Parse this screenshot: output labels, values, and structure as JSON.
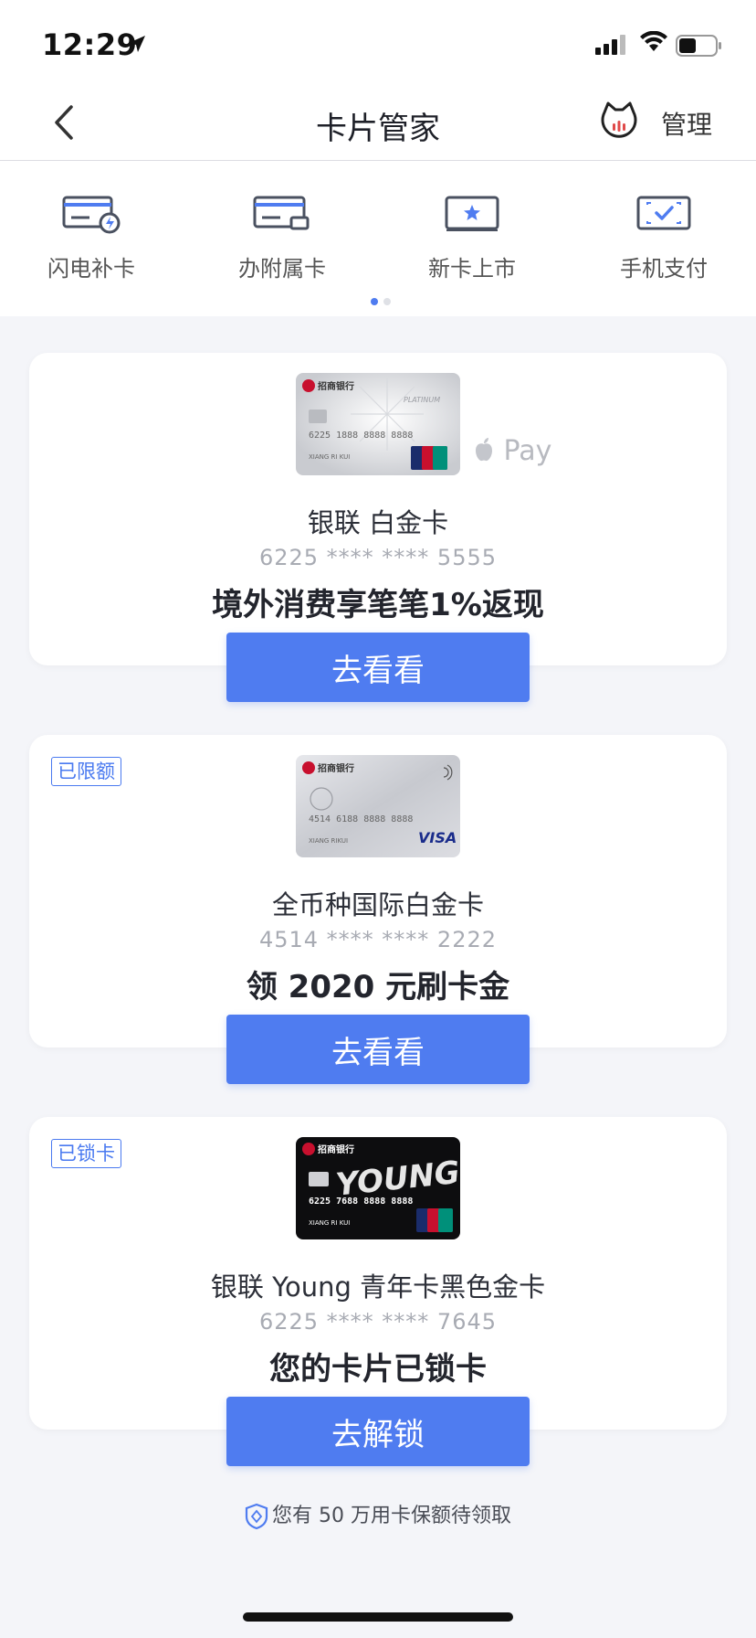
{
  "status_bar": {
    "time": "12:29"
  },
  "nav": {
    "title": "卡片管家",
    "manage_label": "管理"
  },
  "quick_actions": [
    {
      "label": "闪电补卡",
      "icon": "card-lightning-icon"
    },
    {
      "label": "办附属卡",
      "icon": "card-secondary-icon"
    },
    {
      "label": "新卡上市",
      "icon": "card-star-icon"
    },
    {
      "label": "手机支付",
      "icon": "card-check-icon"
    }
  ],
  "cards": [
    {
      "badge": "",
      "image_text": {
        "bank": "招商银行",
        "number": "6225 1888 8888 8888",
        "holder": "XIANG RI KUI",
        "tier": "PLATINUM"
      },
      "apple_pay": "Pay",
      "name": "银联 白金卡",
      "number": "6225 **** **** 5555",
      "promo": "境外消费享笔笔1%返现",
      "button": "去看看"
    },
    {
      "badge": "已限额",
      "image_text": {
        "bank": "招商银行",
        "number": "4514 6188 8888 8888",
        "holder": "XIANG RIKUI",
        "network": "VISA"
      },
      "name": "全币种国际白金卡",
      "number": "4514 **** **** 2222",
      "promo": "领 2020 元刷卡金",
      "button": "去看看"
    },
    {
      "badge": "已锁卡",
      "image_text": {
        "bank": "招商银行",
        "brand": "YOUNG",
        "number": "6225 7688 8888 8888",
        "holder": "XIANG RI KUI"
      },
      "name": "银联 Young 青年卡黑色金卡",
      "number": "6225 **** **** 7645",
      "promo": "您的卡片已锁卡",
      "button": "去解锁"
    }
  ],
  "footer_note": "您有 50 万用卡保额待领取",
  "colors": {
    "accent": "#4f7cf0",
    "badge": "#4a7af0",
    "background": "#f4f5f9"
  }
}
